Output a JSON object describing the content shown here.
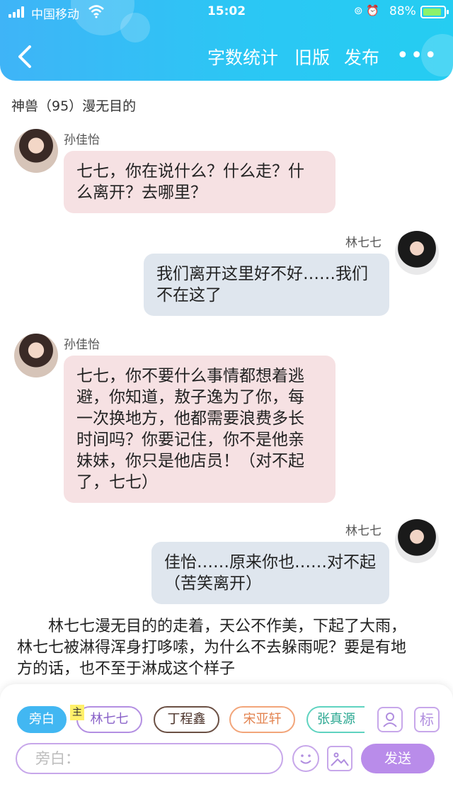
{
  "status_bar": {
    "carrier": "中国移动",
    "time": "15:02",
    "battery_percent": "88%",
    "battery_level": 0.88
  },
  "header": {
    "back_icon": "chevron-left-icon",
    "nav": [
      "字数统计",
      "旧版",
      "发布"
    ],
    "more_label": "•••"
  },
  "story": {
    "title": "神兽（95）漫无目的"
  },
  "messages": [
    {
      "sender": "孙佳怡",
      "side": "left",
      "text_lines": [
        "七七，你在说什么？什么走？什",
        "么离开？去哪里？"
      ]
    },
    {
      "sender": "林七七",
      "side": "right",
      "text_lines": [
        "我们离开这里好不好……我们",
        "不在这了"
      ]
    },
    {
      "sender": "孙佳怡",
      "side": "left",
      "text_lines": [
        "七七，你不要什么事情都想着逃",
        "避，你知道，敖子逸为了你，每",
        "一次换地方，他都需要浪费多长",
        "时间吗？你要记住，你不是他亲",
        "妹妹，你只是他店员！（对不起",
        "了，七七）"
      ]
    },
    {
      "sender": "林七七",
      "side": "right",
      "text_lines": [
        "佳怡……原来你也……对不起",
        "（苦笑离开）"
      ]
    }
  ],
  "narration": "林七七漫无目的的走着，天公不作美，下起了大雨，林七七被淋得浑身打哆嗦，为什么不去躲雨呢？要是有地方的话，也不至于淋成这个样子",
  "composer": {
    "roles": [
      "旁白",
      "林七七",
      "丁程鑫",
      "宋亚轩",
      "张真源"
    ],
    "main_tag": "主",
    "tag_button_label": "标",
    "input_placeholder": "旁白：",
    "send_label": "发送"
  }
}
